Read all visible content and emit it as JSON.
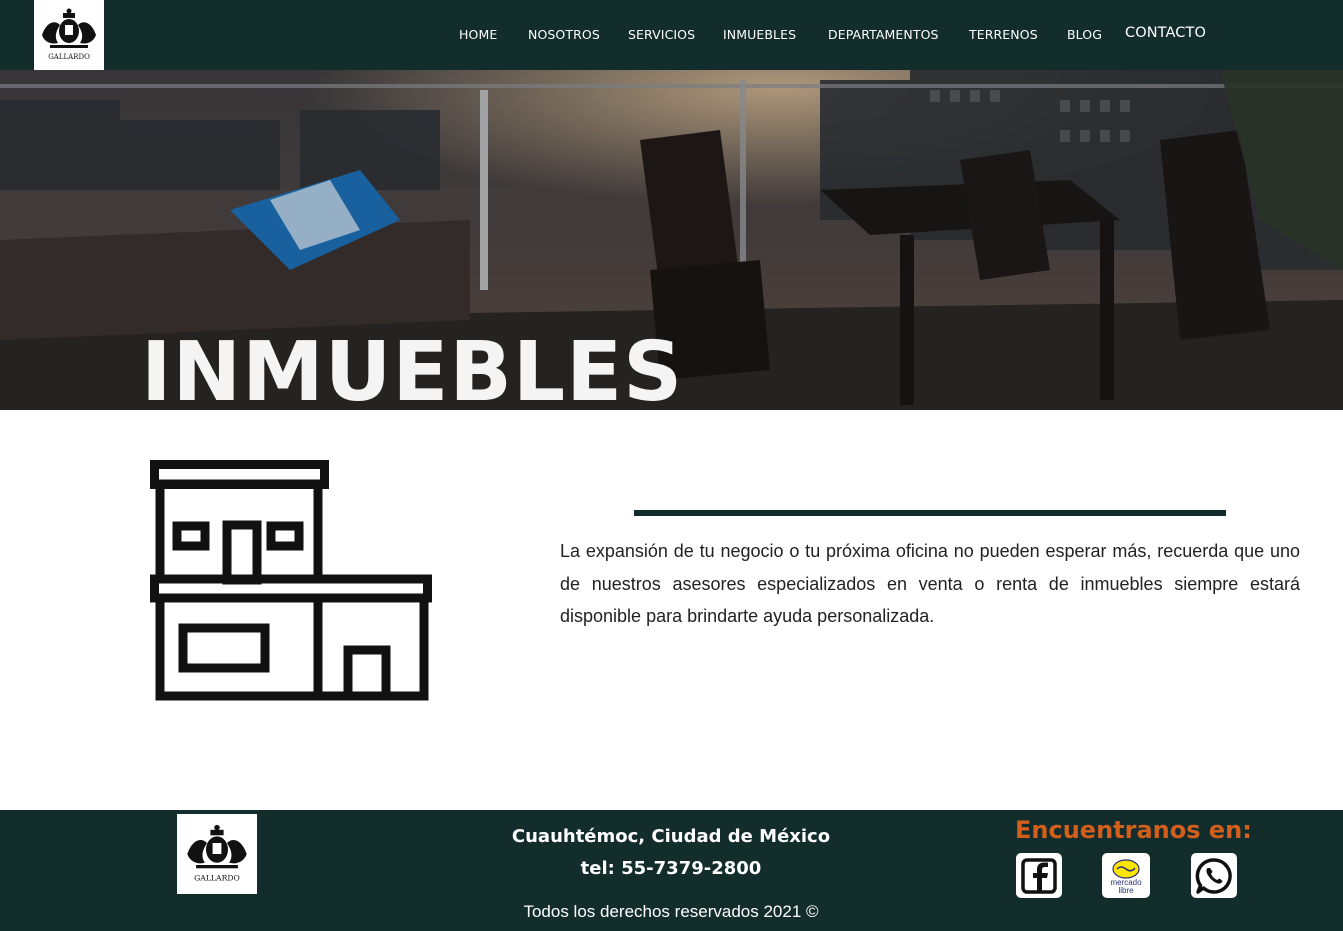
{
  "nav": {
    "logo_text": "GALLARDO",
    "items": [
      "HOME",
      "NOSOTROS",
      "SERVICIOS",
      "INMUEBLES",
      "DEPARTAMENTOS",
      "TERRENOS",
      "BLOG"
    ],
    "contact": "CONTACTO"
  },
  "hero": {
    "title": "INMUEBLES"
  },
  "content": {
    "text": "La expansión de tu negocio o tu próxima oficina no pueden esperar más, recuerda que uno de nuestros asesores especializados en venta o renta de inmuebles siempre estará disponible para brindarte ayuda personalizada."
  },
  "footer": {
    "logo_text": "GALLARDO",
    "address": "Cuauhtémoc, Ciudad de México",
    "phone": "tel: 55-7379-2800",
    "rights": "Todos los derechos reservados 2021 ©",
    "find_us": "Encuentranos en:",
    "social": [
      "facebook-icon",
      "mercadolibre-icon",
      "whatsapp-icon"
    ],
    "mercadolibre_label_1": "mercado",
    "mercadolibre_label_2": "libre"
  },
  "colors": {
    "brand_dark": "#122d2b",
    "accent": "#d35f1c",
    "white": "#ffffff"
  }
}
